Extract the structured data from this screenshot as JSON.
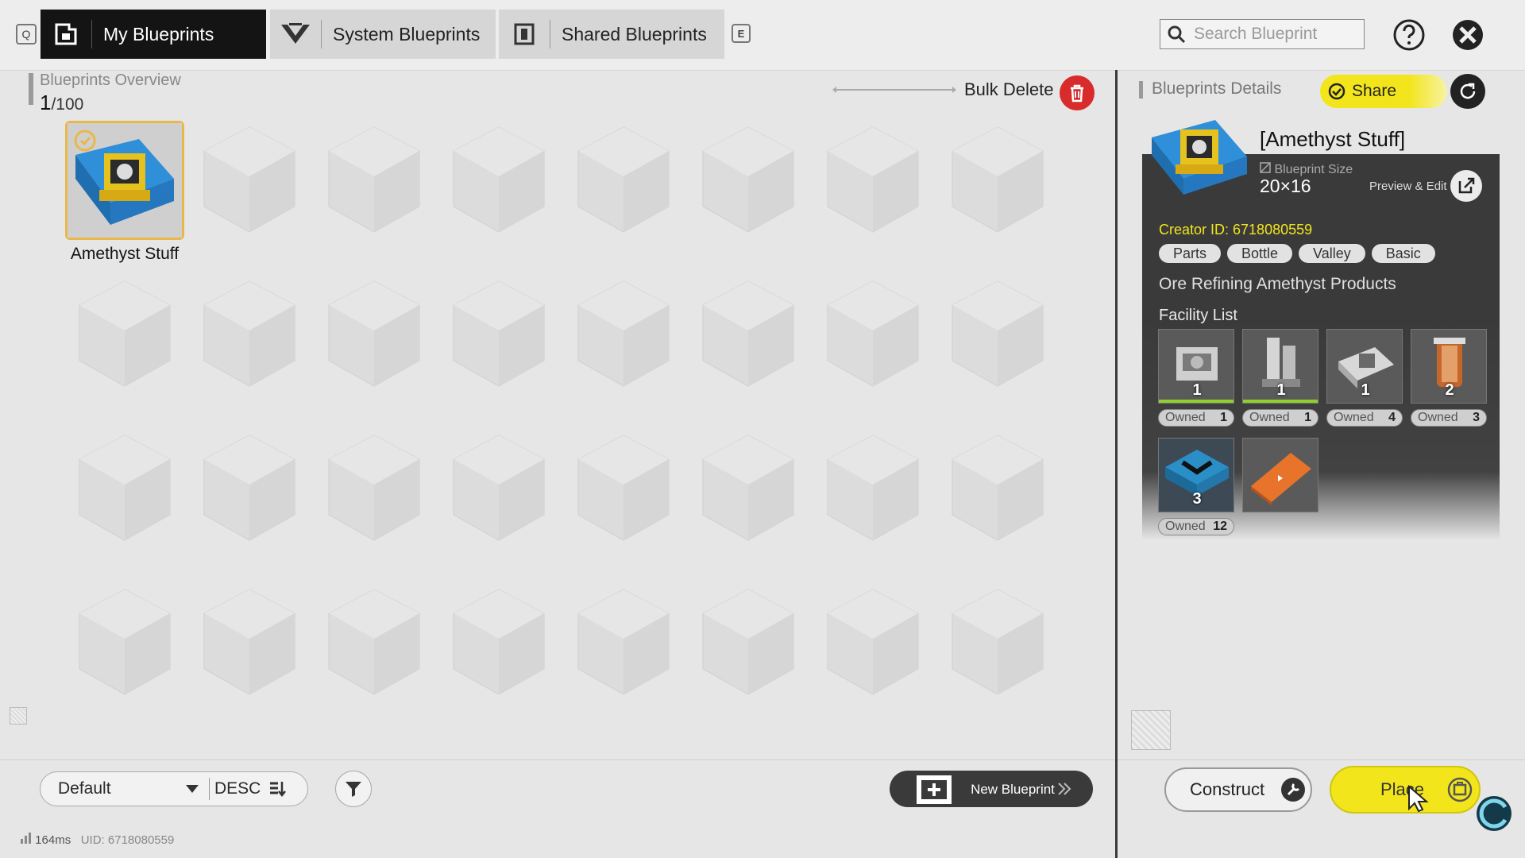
{
  "topbar": {
    "q_key": "Q",
    "e_key": "E",
    "tabs": [
      {
        "label": "My Blueprints",
        "active": true
      },
      {
        "label": "System Blueprints",
        "active": false
      },
      {
        "label": "Shared Blueprints",
        "active": false
      }
    ],
    "search_placeholder": "Search Blueprint"
  },
  "overview": {
    "title": "Blueprints Overview",
    "count_current": "1",
    "count_total": "/100",
    "bulk_delete_label": "Bulk Delete",
    "blueprints": [
      {
        "name": "Amethyst Stuff"
      }
    ]
  },
  "bottombar": {
    "sort_default": "Default",
    "sort_order": "DESC",
    "new_blueprint_label": "New Blueprint",
    "ping": "164ms",
    "uid": "UID: 6718080559"
  },
  "details": {
    "title": "Blueprints Details",
    "share_label": "Share",
    "name": "[Amethyst Stuff]",
    "size_label": "Blueprint Size",
    "size_value": "20×16",
    "preview_label": "Preview & Edit",
    "creator": "Creator ID: 6718080559",
    "tags": [
      "Parts",
      "Bottle",
      "Valley",
      "Basic"
    ],
    "description": "Ore Refining Amethyst Products",
    "facility_title": "Facility List",
    "owned_label": "Owned",
    "facilities": [
      {
        "count": "1",
        "owned": "1",
        "color": "#9a9a9a"
      },
      {
        "count": "1",
        "owned": "1",
        "color": "#9a9a9a"
      },
      {
        "count": "1",
        "owned": "4",
        "color": "#9a9a9a"
      },
      {
        "count": "2",
        "owned": "3",
        "color": "#c7662a"
      },
      {
        "count": "3",
        "owned": "12",
        "color": "#2a8fc7"
      },
      {
        "count": "",
        "owned": "",
        "color": "#e8732a"
      }
    ],
    "construct_label": "Construct",
    "place_label": "Place"
  }
}
